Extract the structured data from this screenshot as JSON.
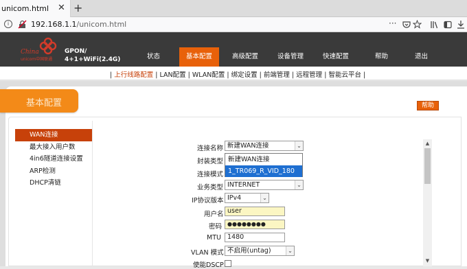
{
  "browser": {
    "tab_title": "unicom.html",
    "tab_close": "✕",
    "new_tab": "+",
    "url_host": "192.168.1.1",
    "url_path": "/unicom.html",
    "icons": [
      "info-icon",
      "insecure-icon",
      "more-icon",
      "pocket-icon",
      "star-icon",
      "library-icon",
      "sidebar-icon",
      "download-icon"
    ]
  },
  "header": {
    "logo_cn": "China",
    "logo_en": "unicom中国联通",
    "model_line1": "GPON/",
    "model_line2": "4+1+WiFi(2.4G)",
    "menu": [
      "状态",
      "基本配置",
      "高级配置",
      "设备管理",
      "快速配置",
      "帮助",
      "退出"
    ],
    "active_menu": "基本配置"
  },
  "subnav": {
    "sep_start": "| ",
    "items": [
      "上行线路配置",
      "LAN配置",
      "WLAN配置",
      "绑定设置",
      "前端管理",
      "远程管理",
      "智能云平台"
    ],
    "sep": " | ",
    "sep_end": " |"
  },
  "page": {
    "title": "基本配置",
    "help_label": "帮助"
  },
  "sidebar": {
    "items": [
      "WAN连接",
      "最大接入用户数",
      "4in6隧道连接设置",
      "ARP检测",
      "DHCP清链"
    ],
    "active_index": 0
  },
  "form": {
    "conn_name_label": "连接名称",
    "conn_name_value": "新建WAN连接",
    "encap_label": "封装类型",
    "mode_label": "连接模式",
    "service_label": "业务类型",
    "service_value": "INTERNET",
    "ip_version_label": "IP协议版本",
    "ip_version_value": "IPv4",
    "username_label": "用户名",
    "username_value": "user",
    "password_label": "密码",
    "password_value": "●●●●●●●●",
    "mtu_label": "MTU",
    "mtu_value": "1480",
    "vlan_label": "VLAN 模式",
    "vlan_value": "不启用(untag)",
    "dscp_label": "使能DSCP"
  },
  "dropdown": {
    "options": [
      "新建WAN连接",
      "1_TR069_R_VID_180"
    ],
    "highlighted_index": 1
  },
  "colors": {
    "accent": "#e8610a",
    "sidebar_active": "#c7410a",
    "title_tab": "#f38a18",
    "header_bg": "#3a3a3a",
    "dropdown_highlight": "#1e6fd1"
  }
}
